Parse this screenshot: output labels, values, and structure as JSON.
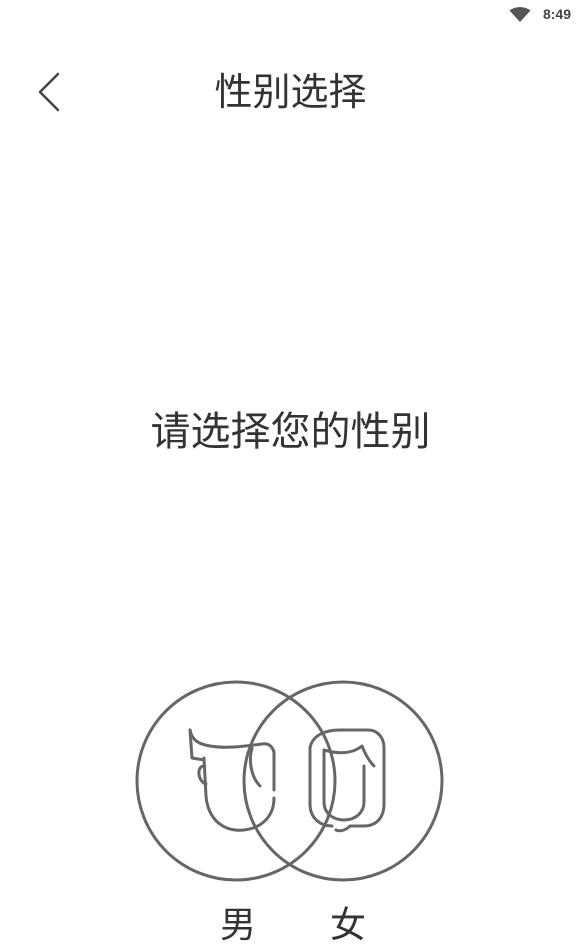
{
  "status_bar": {
    "time": "8:49",
    "wifi_icon": "wifi-icon"
  },
  "header": {
    "title": "性别选择",
    "back_icon": "chevron-left-icon"
  },
  "main": {
    "prompt": "请选择您的性别",
    "options": [
      {
        "label": "男",
        "icon": "male-face-icon"
      },
      {
        "label": "女",
        "icon": "female-face-icon"
      }
    ]
  },
  "colors": {
    "line": "#666666",
    "text": "#333333",
    "background": "#ffffff"
  }
}
